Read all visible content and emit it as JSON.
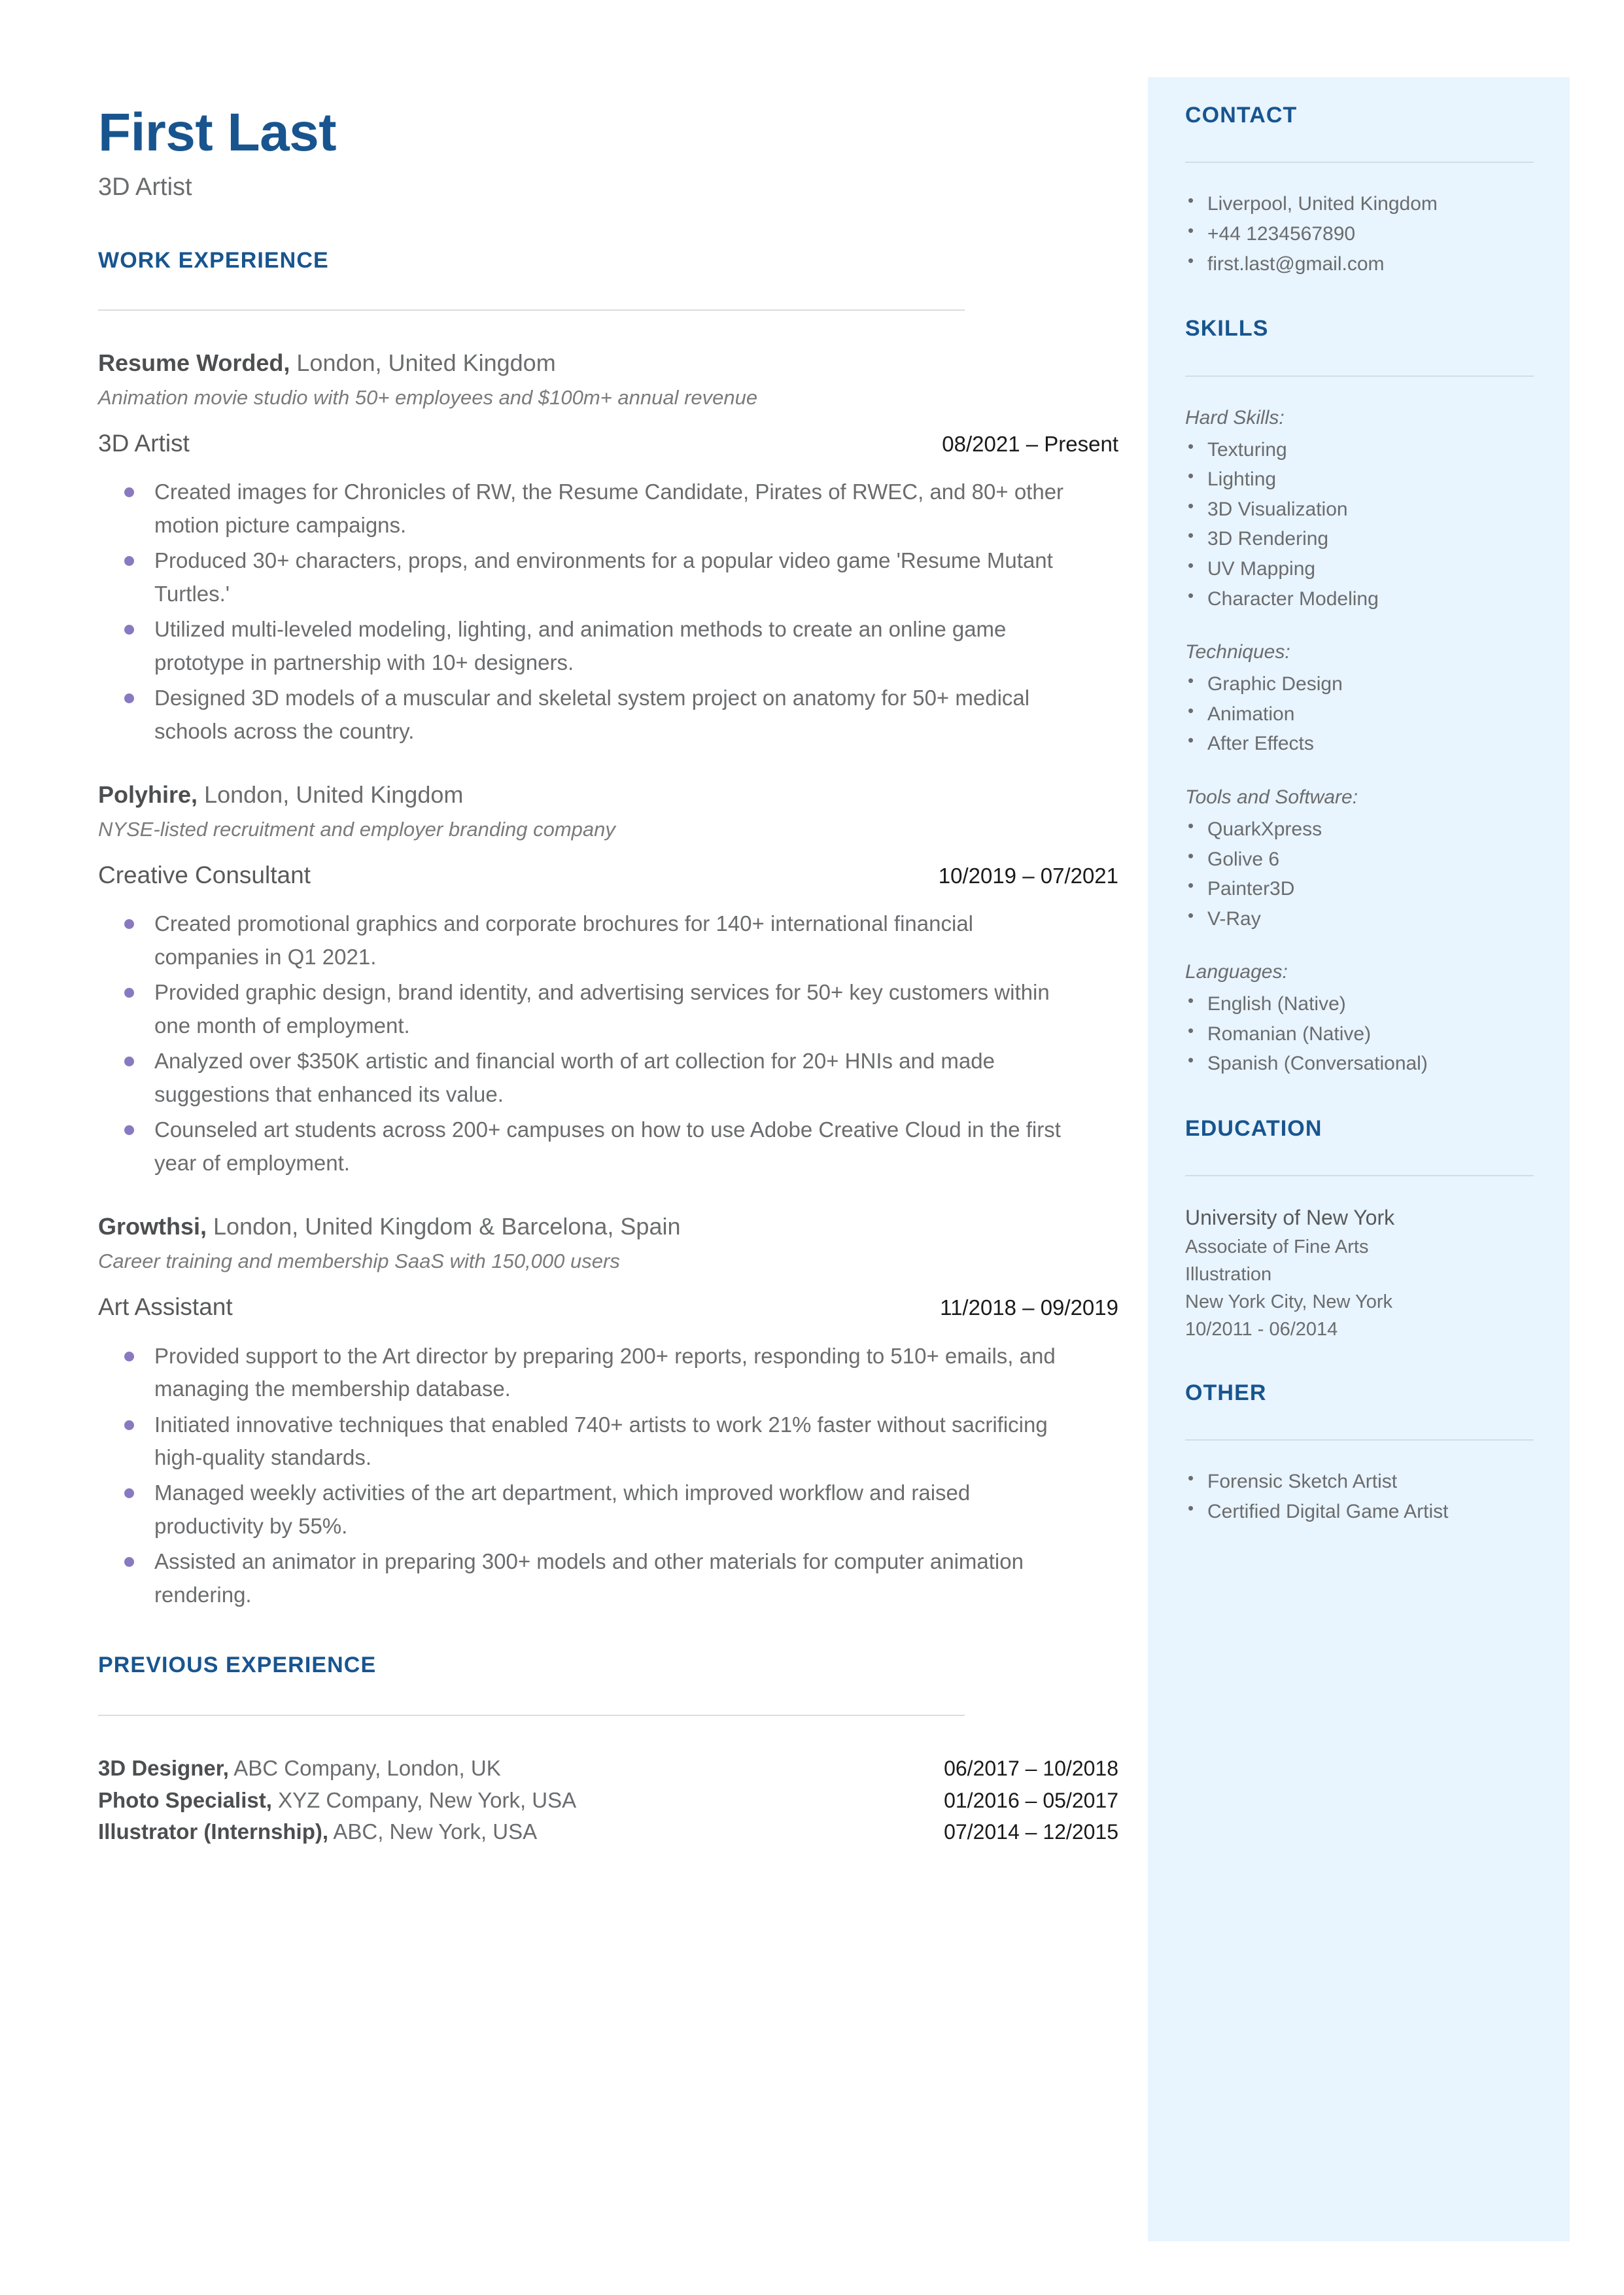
{
  "header": {
    "name": "First Last",
    "headline": "3D Artist"
  },
  "main": {
    "work_experience_heading": "WORK EXPERIENCE",
    "previous_experience_heading": "PREVIOUS EXPERIENCE",
    "jobs": [
      {
        "company": "Resume Worded,",
        "location": " London, United Kingdom",
        "description": "Animation movie studio with 50+ employees and $100m+ annual revenue",
        "role": "3D Artist",
        "dates": "08/2021 – Present",
        "bullets": [
          "Created images for Chronicles of RW, the Resume Candidate, Pirates of RWEC, and 80+ other motion picture campaigns.",
          "Produced 30+ characters, props, and environments for a popular video game 'Resume Mutant Turtles.'",
          "Utilized multi-leveled modeling, lighting, and animation methods to create an online game prototype in partnership with 10+ designers.",
          "Designed 3D models of a muscular and skeletal system project on anatomy for 50+ medical schools across the country."
        ]
      },
      {
        "company": "Polyhire,",
        "location": " London, United Kingdom",
        "description": "NYSE-listed recruitment and employer branding company",
        "role": "Creative Consultant",
        "dates": "10/2019 – 07/2021",
        "bullets": [
          "Created promotional graphics and corporate brochures for 140+ international financial companies in Q1 2021.",
          "Provided graphic design, brand identity, and advertising services for 50+ key customers within one month of employment.",
          "Analyzed over $350K artistic and financial worth of art collection for 20+ HNIs and made suggestions that enhanced its value.",
          "Counseled art students across 200+ campuses on how to use Adobe Creative Cloud in the first year of employment."
        ]
      },
      {
        "company": "Growthsi,",
        "location": " London, United Kingdom & Barcelona, Spain",
        "description": "Career training and membership SaaS with 150,000 users",
        "role": "Art Assistant",
        "dates": "11/2018 – 09/2019",
        "bullets": [
          "Provided support to the Art director by preparing 200+ reports, responding to 510+ emails, and managing the membership database.",
          "Initiated innovative techniques that enabled 740+ artists to work 21% faster without sacrificing high-quality standards.",
          "Managed weekly activities of the art department, which improved workflow and raised productivity by 55%.",
          "Assisted an animator in preparing 300+ models and other materials for computer animation rendering."
        ]
      }
    ],
    "previous_experience": [
      {
        "title": "3D Designer,",
        "detail": " ABC Company, London, UK",
        "dates": "06/2017 – 10/2018"
      },
      {
        "title": "Photo Specialist,",
        "detail": " XYZ Company, New York, USA",
        "dates": "01/2016 – 05/2017"
      },
      {
        "title": "Illustrator (Internship),",
        "detail": " ABC, New York, USA",
        "dates": "07/2014 – 12/2015"
      }
    ]
  },
  "sidebar": {
    "contact": {
      "heading": "CONTACT",
      "items": [
        "Liverpool, United Kingdom",
        "+44 1234567890",
        "first.last@gmail.com"
      ]
    },
    "skills": {
      "heading": "SKILLS",
      "groups": [
        {
          "label": "Hard Skills:",
          "items": [
            "Texturing",
            "Lighting",
            "3D Visualization",
            "3D Rendering",
            "UV Mapping",
            "Character Modeling"
          ]
        },
        {
          "label": "Techniques:",
          "items": [
            "Graphic Design",
            "Animation",
            "After Effects"
          ]
        },
        {
          "label": "Tools and Software:",
          "items": [
            "QuarkXpress",
            "Golive 6",
            "Painter3D",
            "V-Ray"
          ]
        },
        {
          "label": "Languages:",
          "items": [
            "English (Native)",
            "Romanian (Native)",
            "Spanish (Conversational)"
          ]
        }
      ]
    },
    "education": {
      "heading": "EDUCATION",
      "school": "University of New York",
      "degree": "Associate of Fine Arts",
      "major": "Illustration",
      "location": "New York City, New York",
      "dates": "10/2011 - 06/2014"
    },
    "other": {
      "heading": "OTHER",
      "items": [
        "Forensic Sketch Artist",
        "Certified Digital Game Artist"
      ]
    }
  },
  "colors": {
    "accent_blue": "#18558f",
    "sidebar_bg": "#e8f4fe",
    "bullet_purple": "#8979c0",
    "body_text": "#6b6c6e"
  }
}
